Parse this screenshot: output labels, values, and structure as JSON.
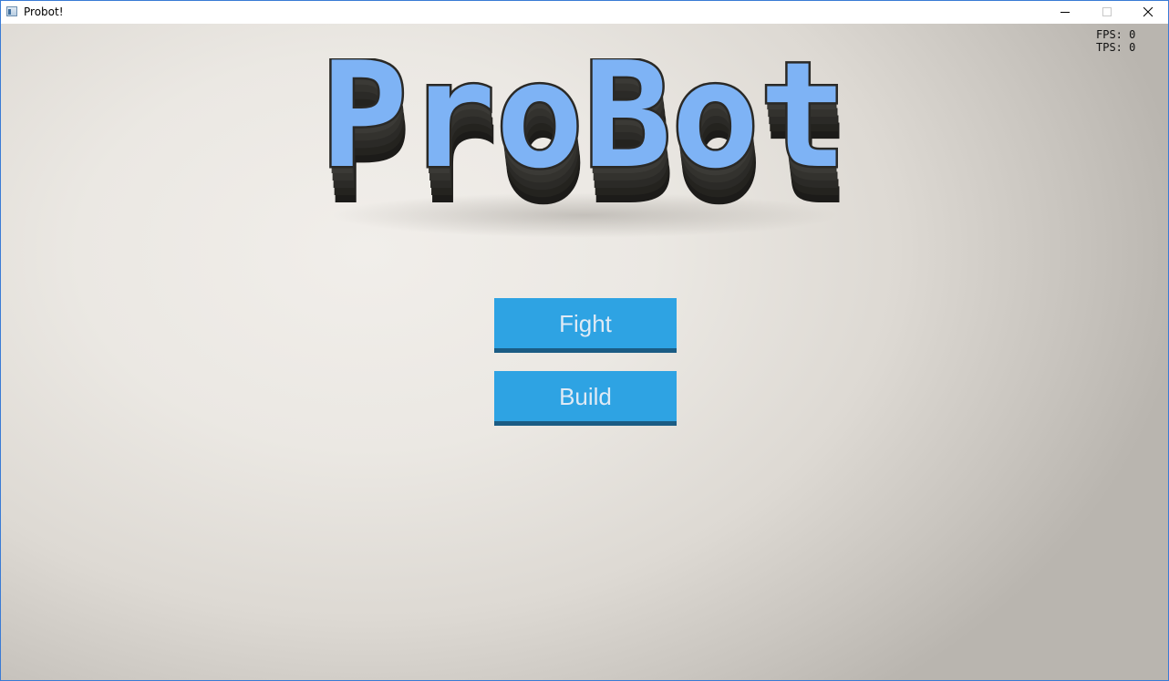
{
  "window": {
    "title": "Probot!",
    "controls": {
      "minimize": "minimize-icon",
      "maximize": "maximize-icon",
      "close": "close-icon"
    }
  },
  "stats": {
    "fps": "FPS: 0",
    "tps": "TPS: 0"
  },
  "logo": {
    "text": "ProBot",
    "face_color": "#7eb3f5",
    "extrude_color": "#2b2a28"
  },
  "menu": {
    "fight_label": "Fight",
    "build_label": "Build",
    "button_color": "#2ea3e3",
    "button_shadow_color": "#1b5c84"
  }
}
